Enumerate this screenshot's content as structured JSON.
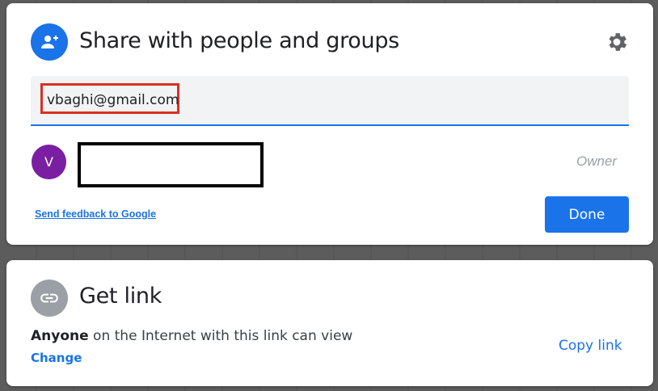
{
  "share": {
    "title": "Share with people and groups",
    "icon": "add-person-icon",
    "settings_icon": "gear-icon",
    "email_input_value": "vbaghi@gmail.com",
    "person": {
      "avatar_initial": "V",
      "avatar_color": "#7b1fa2",
      "role": "Owner"
    },
    "feedback_link": "Send feedback to Google",
    "done_label": "Done"
  },
  "link": {
    "title": "Get link",
    "icon": "link-icon",
    "access_strong": "Anyone",
    "access_rest": " on the Internet with this link can view",
    "change_label": "Change",
    "copy_label": "Copy link"
  },
  "colors": {
    "accent": "#1a73e8",
    "highlight_border": "#d93025",
    "link_icon_bg": "#9aa0a6"
  }
}
